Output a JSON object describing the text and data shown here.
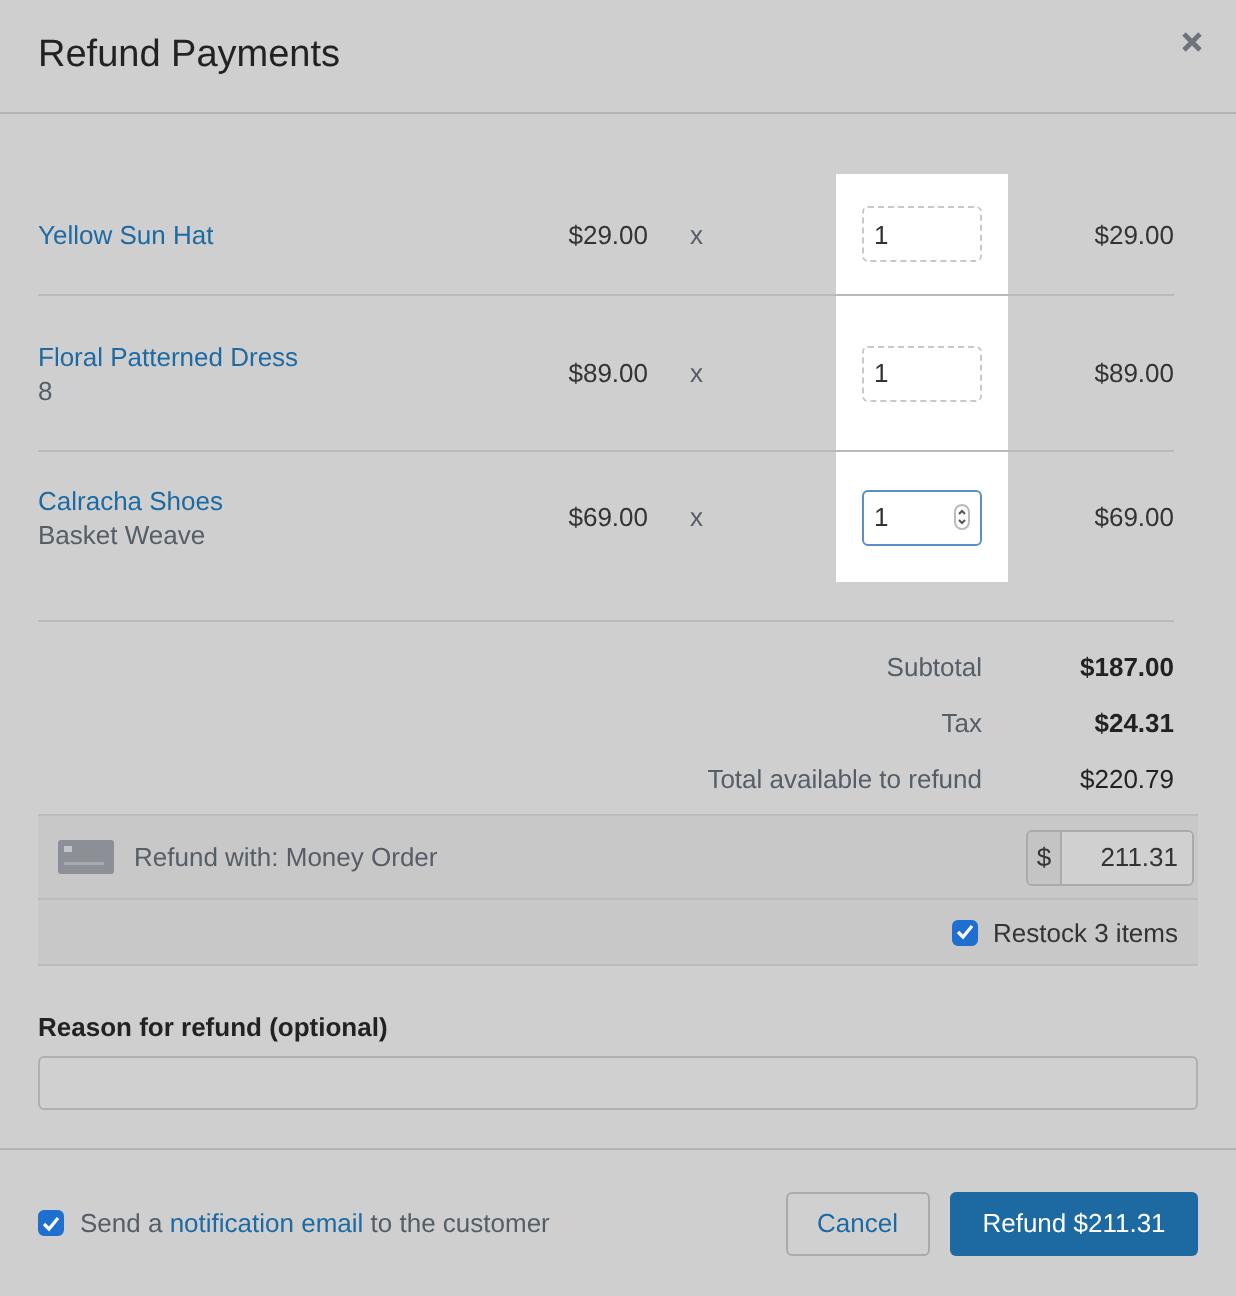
{
  "window": {
    "title": "Refund Payments"
  },
  "items": [
    {
      "name": "Yellow Sun Hat",
      "price": "$29.00",
      "times": "x",
      "quantity": "1",
      "total": "$29.00",
      "focused": false
    },
    {
      "name": "Floral Patterned Dress",
      "variant": "8",
      "price": "$89.00",
      "times": "x",
      "quantity": "1",
      "total": "$89.00",
      "focused": false
    },
    {
      "name": "Calracha Shoes",
      "variant": "Basket Weave",
      "price": "$69.00",
      "times": "x",
      "quantity": "1",
      "total": "$69.00",
      "focused": true
    }
  ],
  "totals": [
    {
      "label": "Subtotal",
      "value": "$187.00",
      "kind": "bold"
    },
    {
      "label": "Tax",
      "value": "$24.31",
      "kind": "bold"
    },
    {
      "label": "Total available to refund",
      "value": "$220.79",
      "kind": "plain"
    }
  ],
  "payment": {
    "label": "Refund with: Money Order",
    "currency": "$",
    "amount": "211.31"
  },
  "restock": {
    "label": "Restock 3 items",
    "checked": true
  },
  "reason": {
    "label": "Reason for refund (optional)"
  },
  "notify": {
    "before": "Send a",
    "link": "notification email",
    "after": "to the customer",
    "checked": true
  },
  "buttons": {
    "cancel": "Cancel",
    "refund": "Refund $211.31"
  }
}
